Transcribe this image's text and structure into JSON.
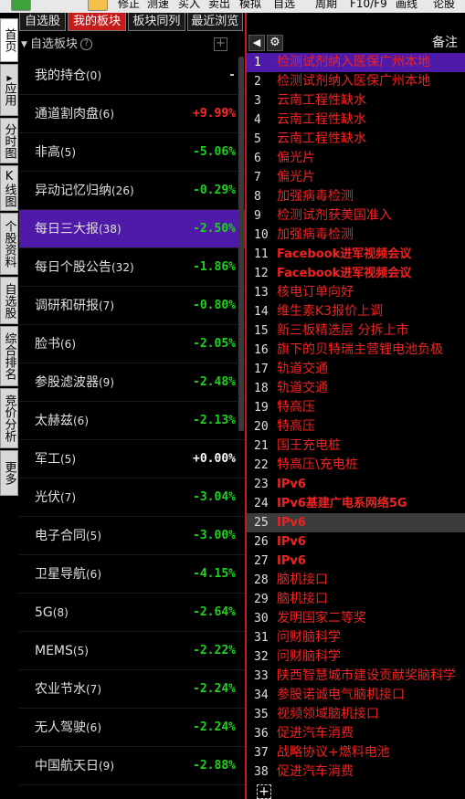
{
  "toolbar": {
    "items": [
      {
        "label": "修正"
      },
      {
        "label": "测速"
      },
      {
        "label": "买入"
      },
      {
        "label": "卖出"
      },
      {
        "label": "模拟"
      },
      {
        "label": "自选"
      },
      {
        "label": "周期"
      },
      {
        "label": "F10/F9"
      },
      {
        "label": "画线"
      },
      {
        "label": "论股"
      }
    ]
  },
  "left_nav": {
    "items": [
      {
        "label": "首页"
      },
      {
        "label": "应用"
      },
      {
        "label": "分时图"
      },
      {
        "label": "K线图"
      },
      {
        "label": "个股资料"
      },
      {
        "label": "自选股"
      },
      {
        "label": "综合排名"
      },
      {
        "label": "竞价分析"
      },
      {
        "label": "更多"
      }
    ]
  },
  "tabs": [
    {
      "label": "自选股"
    },
    {
      "label": "我的板块"
    },
    {
      "label": "板块同列"
    },
    {
      "label": "最近浏览"
    }
  ],
  "panel": {
    "title": "自选板块",
    "help": "?"
  },
  "blocks": [
    {
      "name": "我的持仓",
      "count": "(0)",
      "pct": "-",
      "color": "#cfcfcf"
    },
    {
      "name": "通道割肉盘",
      "count": "(6)",
      "pct": "+9.99%",
      "color": "#ff2b2b"
    },
    {
      "name": "非高",
      "count": "(5)",
      "pct": "-5.06%",
      "color": "#1fd21f"
    },
    {
      "name": "异动记忆归纳",
      "count": "(26)",
      "pct": "-0.29%",
      "color": "#1fd21f"
    },
    {
      "name": "每日三大报",
      "count": "(38)",
      "pct": "-2.50%",
      "color": "#1fd21f"
    },
    {
      "name": "每日个股公告",
      "count": "(32)",
      "pct": "-1.86%",
      "color": "#1fd21f"
    },
    {
      "name": "调研和研报",
      "count": "(7)",
      "pct": "-0.80%",
      "color": "#1fd21f"
    },
    {
      "name": "脸书",
      "count": "(6)",
      "pct": "-2.05%",
      "color": "#1fd21f"
    },
    {
      "name": "参股滤波器",
      "count": "(9)",
      "pct": "-2.48%",
      "color": "#1fd21f"
    },
    {
      "name": "太赫兹",
      "count": "(6)",
      "pct": "-2.13%",
      "color": "#1fd21f"
    },
    {
      "name": "军工",
      "count": "(5)",
      "pct": "+0.00%",
      "color": "#ffffff"
    },
    {
      "name": "光伏",
      "count": "(7)",
      "pct": "-3.04%",
      "color": "#1fd21f"
    },
    {
      "name": "电子合同",
      "count": "(5)",
      "pct": "-3.00%",
      "color": "#1fd21f"
    },
    {
      "name": "卫星导航",
      "count": "(6)",
      "pct": "-4.15%",
      "color": "#1fd21f"
    },
    {
      "name": "5G",
      "count": "(8)",
      "pct": "-2.64%",
      "color": "#1fd21f"
    },
    {
      "name": "MEMS",
      "count": "(5)",
      "pct": "-2.22%",
      "color": "#1fd21f"
    },
    {
      "name": "农业节水",
      "count": "(7)",
      "pct": "-2.24%",
      "color": "#1fd21f"
    },
    {
      "name": "无人驾驶",
      "count": "(6)",
      "pct": "-2.24%",
      "color": "#1fd21f"
    },
    {
      "name": "中国航天日",
      "count": "(9)",
      "pct": "-2.88%",
      "color": "#1fd21f"
    }
  ],
  "right_header": {
    "title": "备注"
  },
  "notes": [
    {
      "n": "1",
      "text": "检测试剂纳入医保广州本地"
    },
    {
      "n": "2",
      "text": "检测试剂纳入医保广州本地"
    },
    {
      "n": "3",
      "text": "云南工程性缺水"
    },
    {
      "n": "4",
      "text": "云南工程性缺水"
    },
    {
      "n": "5",
      "text": "云南工程性缺水"
    },
    {
      "n": "6",
      "text": "偏光片"
    },
    {
      "n": "7",
      "text": "偏光片"
    },
    {
      "n": "8",
      "text": "加强病毒检测"
    },
    {
      "n": "9",
      "text": "检测试剂获美国准入"
    },
    {
      "n": "10",
      "text": "加强病毒检测"
    },
    {
      "n": "11",
      "text": "Facebook进军视频会议"
    },
    {
      "n": "12",
      "text": "Facebook进军视频会议"
    },
    {
      "n": "13",
      "text": "核电订单向好"
    },
    {
      "n": "14",
      "text": "维生素K3报价上调"
    },
    {
      "n": "15",
      "text": "新三板精选层 分拆上市"
    },
    {
      "n": "16",
      "text": "旗下的贝特瑞主营锂电池负极"
    },
    {
      "n": "17",
      "text": "轨道交通"
    },
    {
      "n": "18",
      "text": "轨道交通"
    },
    {
      "n": "19",
      "text": "特高压"
    },
    {
      "n": "20",
      "text": "特高压"
    },
    {
      "n": "21",
      "text": "国王充电桩"
    },
    {
      "n": "22",
      "text": "特高压\\充电桩"
    },
    {
      "n": "23",
      "text": "IPv6"
    },
    {
      "n": "24",
      "text": "IPv6基建广电系网络5G"
    },
    {
      "n": "25",
      "text": "IPv6"
    },
    {
      "n": "26",
      "text": "IPv6"
    },
    {
      "n": "27",
      "text": "IPv6"
    },
    {
      "n": "28",
      "text": "脑机接口"
    },
    {
      "n": "29",
      "text": "脑机接口"
    },
    {
      "n": "30",
      "text": "发明国家二等奖"
    },
    {
      "n": "31",
      "text": "问财脑科学"
    },
    {
      "n": "32",
      "text": "问财脑科学"
    },
    {
      "n": "33",
      "text": "陕西智慧城市建设贡献奖脑科学"
    },
    {
      "n": "34",
      "text": "参股诺诚电气脑机接口"
    },
    {
      "n": "35",
      "text": "视频领域脑机接口"
    },
    {
      "n": "36",
      "text": "促进汽车消费"
    },
    {
      "n": "37",
      "text": "战略协议+燃料电池"
    },
    {
      "n": "38",
      "text": "促进汽车消费"
    }
  ],
  "colors": {
    "accent_red": "#c61b1b",
    "selection_purple": "#4f1aa8",
    "up_red": "#ff2b2b",
    "down_green": "#1fd21f",
    "note_red": "#ee2222"
  }
}
